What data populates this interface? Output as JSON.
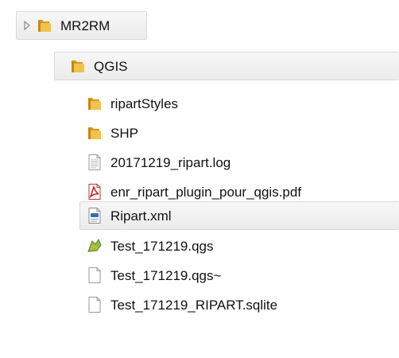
{
  "tree": {
    "root": {
      "label": "MR2RM",
      "expander": "triangle-right-icon",
      "icon": "folder-icon"
    },
    "child": {
      "label": "QGIS",
      "icon": "folder-icon"
    },
    "items": [
      {
        "label": "ripartStyles",
        "icon": "folder-icon"
      },
      {
        "label": "SHP",
        "icon": "folder-icon"
      },
      {
        "label": "20171219_ripart.log",
        "icon": "text-file-icon"
      },
      {
        "label": "enr_ripart_plugin_pour_qgis.pdf",
        "icon": "pdf-file-icon"
      },
      {
        "label": "Ripart.xml",
        "icon": "xml-file-icon"
      },
      {
        "label": "Test_171219.qgs",
        "icon": "qgis-project-icon"
      },
      {
        "label": "Test_171219.qgs~",
        "icon": "blank-file-icon"
      },
      {
        "label": "Test_171219_RIPART.sqlite",
        "icon": "blank-file-icon"
      }
    ]
  },
  "colors": {
    "folder": "#e8b33a",
    "pdf_red": "#c8241b",
    "xml_blue": "#2f6fc0",
    "qgis_green": "#6aa33a",
    "row_highlight": "#efefef"
  }
}
